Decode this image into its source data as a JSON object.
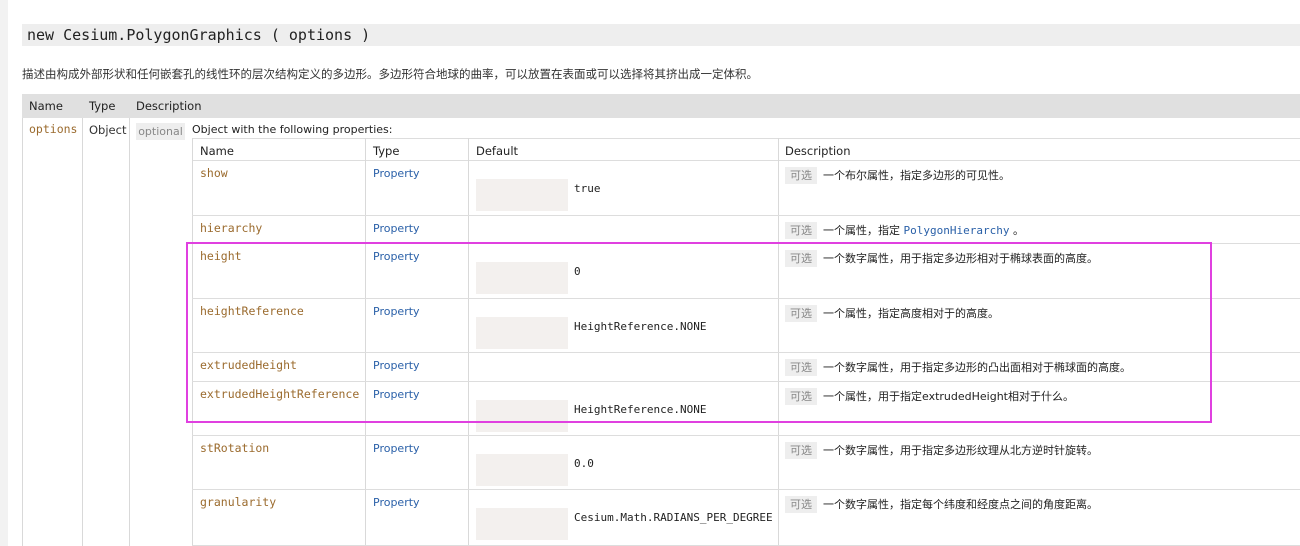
{
  "signature": "new Cesium.PolygonGraphics ( options )",
  "description": "描述由构成外部形状和任何嵌套孔的线性环的层次结构定义的多边形。多边形符合地球的曲率，可以放置在表面或可以选择将其挤出成一定体积。",
  "outer_table": {
    "headers": {
      "name": "Name",
      "type": "Type",
      "description": "Description"
    },
    "row": {
      "name": "options",
      "type": "Object",
      "optional": "optional",
      "description": "Object with the following properties:"
    }
  },
  "inner_table": {
    "headers": {
      "name": "Name",
      "type": "Type",
      "default": "Default",
      "description": "Description"
    },
    "optional_badge": "可选",
    "rows": [
      {
        "name": "show",
        "type": "Property",
        "default": "true",
        "description": "一个布尔属性，指定多边形的可见性。"
      },
      {
        "name": "hierarchy",
        "type": "Property",
        "default": "",
        "description_prefix": "一个属性，指定",
        "description_code": "PolygonHierarchy",
        "description_suffix": "。"
      },
      {
        "name": "height",
        "type": "Property",
        "default": "0",
        "description": "一个数字属性，用于指定多边形相对于椭球表面的高度。"
      },
      {
        "name": "heightReference",
        "type": "Property",
        "default": "HeightReference.NONE",
        "description": "一个属性，指定高度相对于的高度。"
      },
      {
        "name": "extrudedHeight",
        "type": "Property",
        "default": "",
        "description": "一个数字属性，用于指定多边形的凸出面相对于椭球面的高度。"
      },
      {
        "name": "extrudedHeightReference",
        "type": "Property",
        "default": "HeightReference.NONE",
        "description": "一个属性，用于指定extrudedHeight相对于什么。"
      },
      {
        "name": "stRotation",
        "type": "Property",
        "default": "0.0",
        "description": "一个数字属性，用于指定多边形纹理从北方逆时针旋转。"
      },
      {
        "name": "granularity",
        "type": "Property",
        "default": "Cesium.Math.RADIANS_PER_DEGREE",
        "description": "一个数字属性，指定每个纬度和经度点之间的角度距离。"
      }
    ]
  },
  "colors": {
    "highlight": "#e040e0",
    "param_name": "#9b6b2e",
    "link": "#2a60a8"
  }
}
